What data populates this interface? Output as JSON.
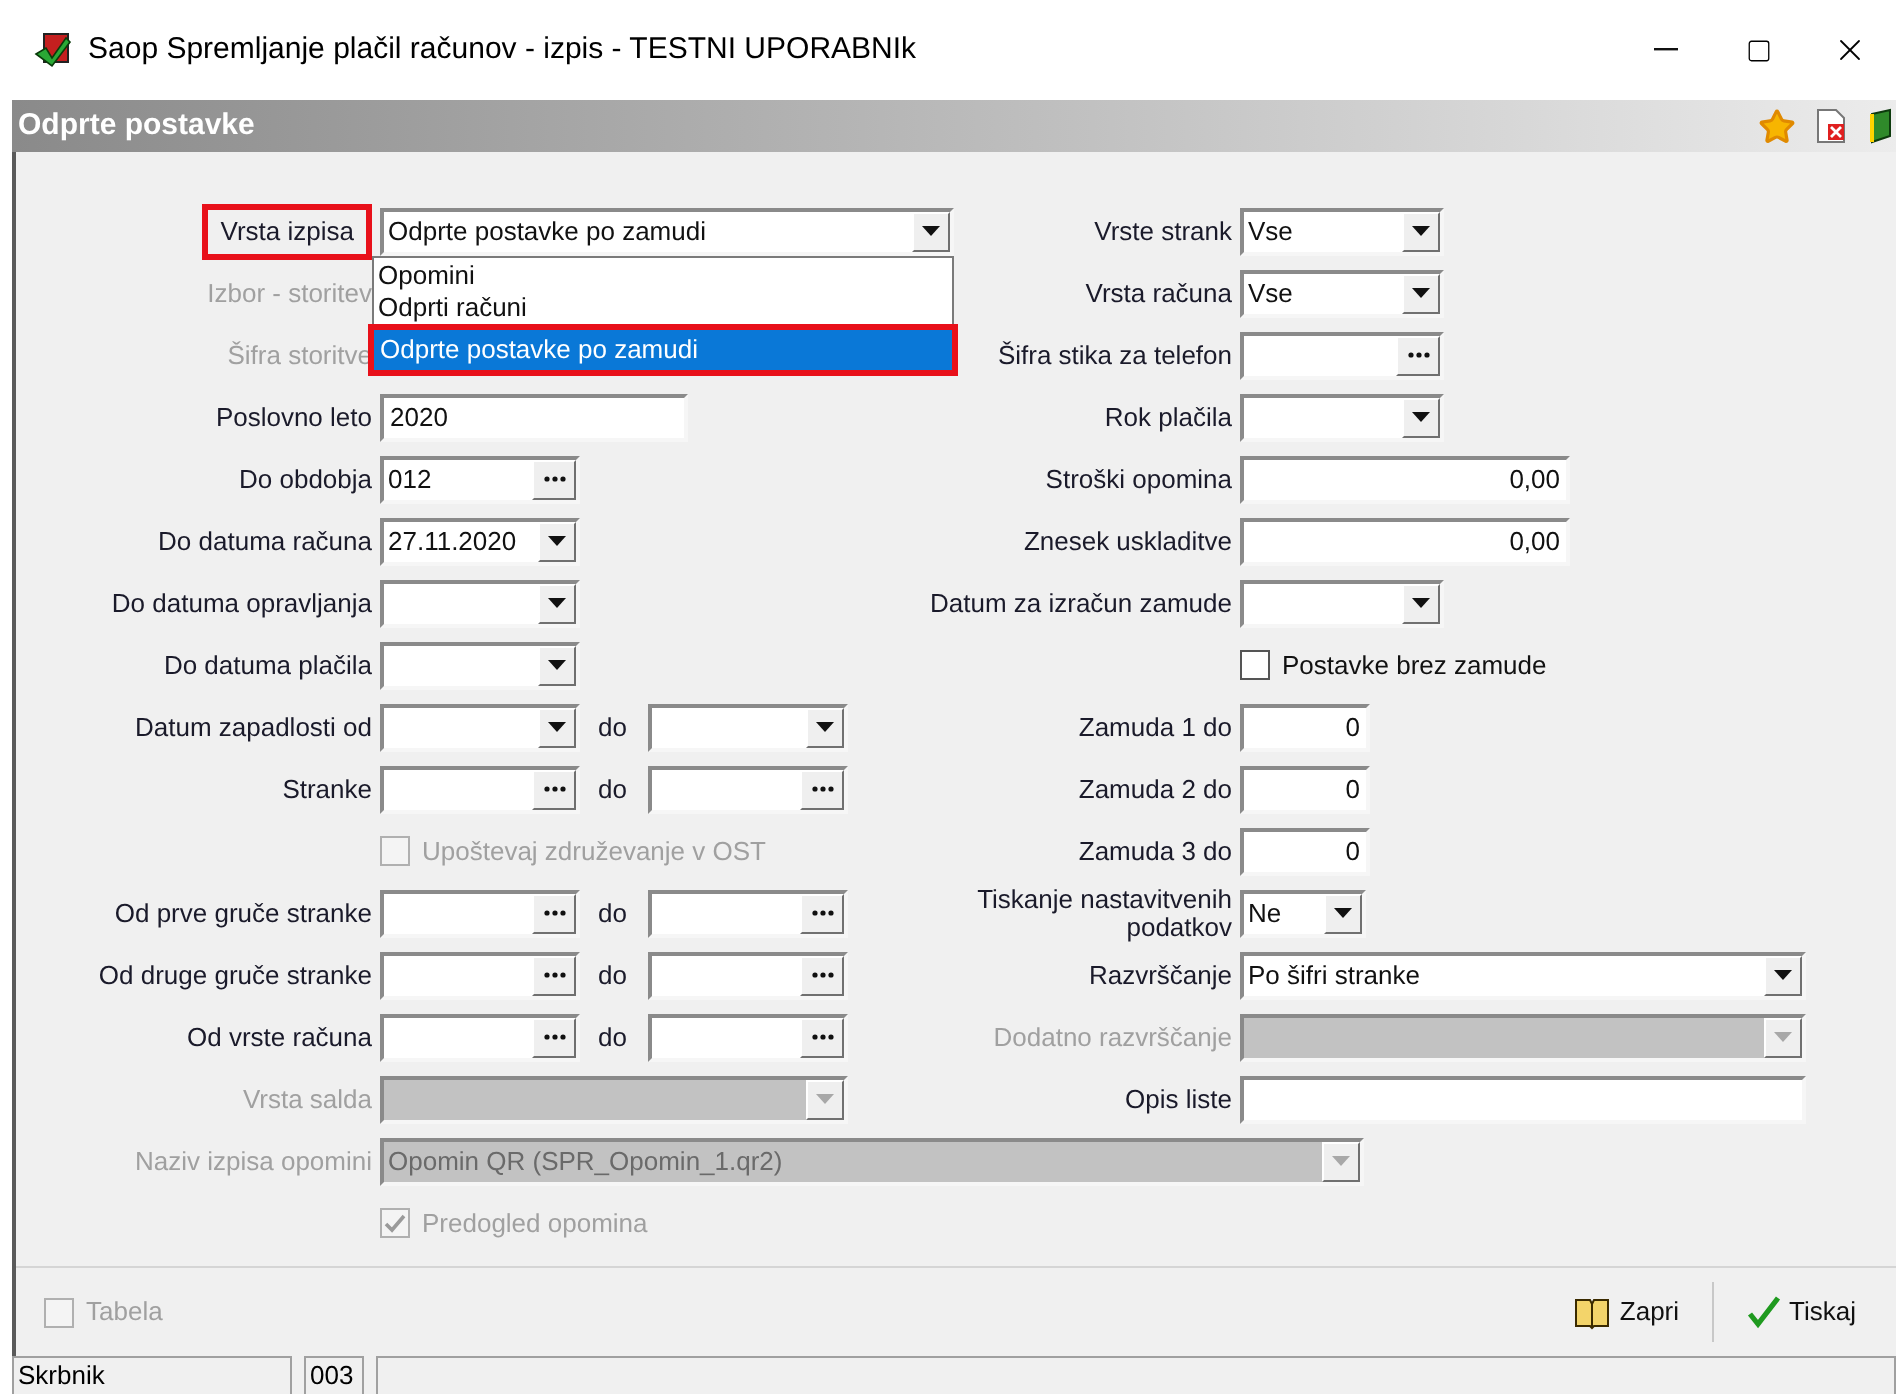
{
  "window": {
    "title": "Saop Spremljanje plačil računov - izpis - TESTNI UPORABNIk"
  },
  "header": {
    "title": "Odprte postavke"
  },
  "left_fields": [
    {
      "label": "Vrsta izpisa",
      "kind": "combo",
      "value": "Odprte postavke po zamudi",
      "disabled": false,
      "annotated": true
    },
    {
      "label": "Izbor - storitev",
      "kind": "covered",
      "disabled": true,
      "annotated": false
    },
    {
      "label": "Šifra storitve",
      "kind": "covered",
      "disabled": true,
      "annotated": false
    },
    {
      "label": "Poslovno leto",
      "kind": "text",
      "value": "2020",
      "disabled": false,
      "annotated": false
    },
    {
      "label": "Do obdobja",
      "kind": "lookup",
      "value": "012",
      "disabled": false,
      "annotated": false
    },
    {
      "label": "Do datuma računa",
      "kind": "combo",
      "value": "27.11.2020",
      "disabled": false,
      "annotated": false
    },
    {
      "label": "Do datuma opravljanja",
      "kind": "combo",
      "disabled": false,
      "annotated": false
    },
    {
      "label": "Do datuma plačila",
      "kind": "combo",
      "disabled": false,
      "annotated": false
    },
    {
      "label": "Datum zapadlosti od",
      "kind": "range_combo",
      "to_label": "do",
      "disabled": false,
      "annotated": false
    },
    {
      "label": "Stranke",
      "kind": "range_lookup",
      "to_label": "do",
      "disabled": false,
      "annotated": false
    },
    {
      "label": "Upoštevaj združevanje v OST",
      "kind": "checkbox",
      "checked": false,
      "disabled": true,
      "annotated": false
    },
    {
      "label": "Od prve gruče stranke",
      "kind": "range_lookup",
      "to_label": "do",
      "disabled": false,
      "annotated": false
    },
    {
      "label": "Od druge gruče stranke",
      "kind": "range_lookup",
      "to_label": "do",
      "disabled": false,
      "annotated": false
    },
    {
      "label": "Od vrste računa",
      "kind": "range_lookup",
      "to_label": "do",
      "disabled": false,
      "annotated": false
    },
    {
      "label": "Vrsta salda",
      "kind": "combo",
      "disabled": true,
      "annotated": false
    }
  ],
  "dropdown": {
    "options": [
      {
        "label": "Opomini",
        "selected": false,
        "annotated": false
      },
      {
        "label": "Odprti računi",
        "selected": false,
        "annotated": false
      },
      {
        "label": "Odprte postavke po zamudi",
        "selected": true,
        "annotated": true
      }
    ]
  },
  "right_fields": [
    {
      "label": "Vrste strank",
      "kind": "combo",
      "value": "Vse",
      "disabled": false
    },
    {
      "label": "Vrsta računa",
      "kind": "combo",
      "value": "Vse",
      "disabled": false
    },
    {
      "label": "Šifra stika za telefon",
      "kind": "lookup",
      "disabled": false
    },
    {
      "label": "Rok plačila",
      "kind": "combo",
      "disabled": false
    },
    {
      "label": "Stroški opomina",
      "kind": "number",
      "value": "0,00",
      "disabled": false
    },
    {
      "label": "Znesek uskladitve",
      "kind": "number",
      "value": "0,00",
      "disabled": false
    },
    {
      "label": "Datum za izračun zamude",
      "kind": "combo",
      "disabled": false
    },
    {
      "label": "Postavke brez zamude",
      "kind": "checkbox",
      "checked": false,
      "disabled": false
    },
    {
      "label": "Zamuda 1 do",
      "kind": "number",
      "value": "0",
      "disabled": false
    },
    {
      "label": "Zamuda 2 do",
      "kind": "number",
      "value": "0",
      "disabled": false
    },
    {
      "label": "Zamuda 3 do",
      "kind": "number",
      "value": "0",
      "disabled": false
    },
    {
      "label": "Tiskanje nastavitvenih podatkov",
      "kind": "combo",
      "value": "Ne",
      "disabled": false
    },
    {
      "label": "Razvrščanje",
      "kind": "combo",
      "value": "Po šifri stranke",
      "disabled": false
    },
    {
      "label": "Dodatno razvrščanje",
      "kind": "combo",
      "disabled": true
    },
    {
      "label": "Opis liste",
      "kind": "text",
      "disabled": false
    }
  ],
  "bottom_fields": [
    {
      "label": "Naziv izpisa opomini",
      "kind": "combo",
      "value": "Opomin QR  (SPR_Opomin_1.qr2)",
      "disabled": true
    },
    {
      "label": "Predogled opomina",
      "kind": "checkbox",
      "checked": true,
      "disabled": true
    }
  ],
  "footer": {
    "table_toggle": {
      "label": "Tabela",
      "checked": false,
      "disabled": true
    },
    "buttons": [
      {
        "label": "Zapri",
        "kind": "close"
      },
      {
        "label": "Tiskaj",
        "kind": "print"
      }
    ]
  },
  "status_bar": [
    {
      "text": "Skrbnik"
    },
    {
      "text": "003"
    }
  ]
}
